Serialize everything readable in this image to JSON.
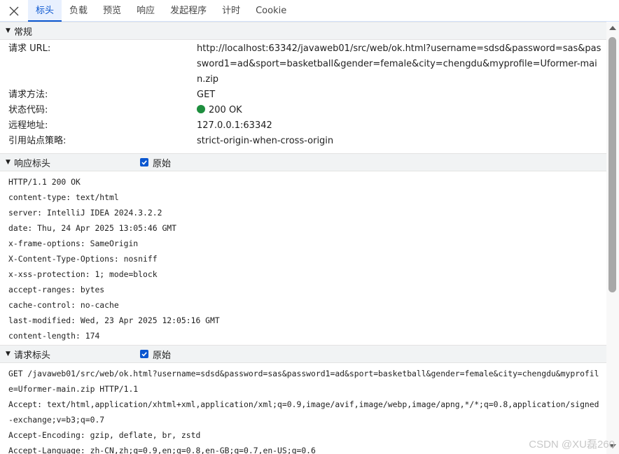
{
  "tabs": [
    {
      "label": "标头",
      "active": true
    },
    {
      "label": "负载",
      "active": false
    },
    {
      "label": "预览",
      "active": false
    },
    {
      "label": "响应",
      "active": false
    },
    {
      "label": "发起程序",
      "active": false
    },
    {
      "label": "计时",
      "active": false
    },
    {
      "label": "Cookie",
      "active": false
    }
  ],
  "general": {
    "title": "常规",
    "rows": [
      {
        "key": "请求 URL:",
        "value": "http://localhost:63342/javaweb01/src/web/ok.html?username=sdsd&password=sas&password1=ad&sport=basketball&gender=female&city=chengdu&myprofile=Uformer-main.zip"
      },
      {
        "key": "请求方法:",
        "value": "GET"
      },
      {
        "key": "状态代码:",
        "value": "200 OK"
      },
      {
        "key": "远程地址:",
        "value": "127.0.0.1:63342"
      },
      {
        "key": "引用站点策略:",
        "value": "strict-origin-when-cross-origin"
      }
    ]
  },
  "response_headers": {
    "title": "响应标头",
    "raw_label": "原始",
    "raw_checked": true,
    "lines": [
      "HTTP/1.1 200 OK",
      "content-type: text/html",
      "server: IntelliJ IDEA 2024.3.2.2",
      "date: Thu, 24 Apr 2025 13:05:46 GMT",
      "x-frame-options: SameOrigin",
      "X-Content-Type-Options: nosniff",
      "x-xss-protection: 1; mode=block",
      "accept-ranges: bytes",
      "cache-control: no-cache",
      "last-modified: Wed, 23 Apr 2025 12:05:16 GMT",
      "content-length: 174"
    ]
  },
  "request_headers": {
    "title": "请求标头",
    "raw_label": "原始",
    "raw_checked": true,
    "lines": [
      "GET /javaweb01/src/web/ok.html?username=sdsd&password=sas&password1=ad&sport=basketball&gender=female&city=chengdu&myprofile=Uformer-main.zip HTTP/1.1",
      "Accept: text/html,application/xhtml+xml,application/xml;q=0.9,image/avif,image/webp,image/apng,*/*;q=0.8,application/signed-exchange;v=b3;q=0.7",
      "Accept-Encoding: gzip, deflate, br, zstd",
      "Accept-Language: zh-CN,zh;q=0.9,en;q=0.8,en-GB;q=0.7,en-US;q=0.6"
    ]
  },
  "watermark": "CSDN @XU磊260",
  "colors": {
    "accent": "#0b57d0",
    "status_ok": "#1e8e3e",
    "section_bg": "#f1f3f4"
  }
}
